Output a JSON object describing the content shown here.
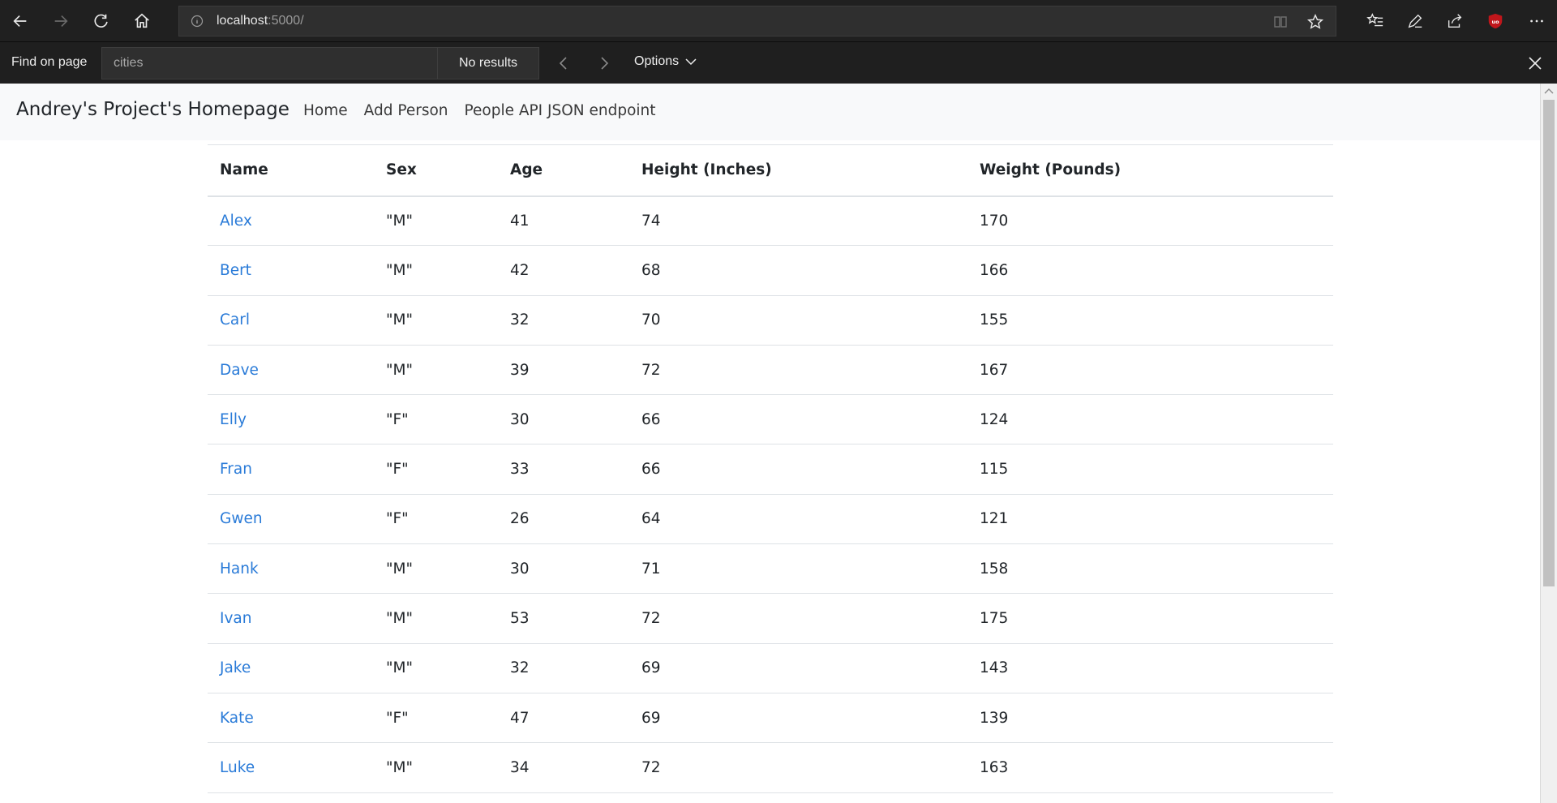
{
  "browser": {
    "url_host": "localhost",
    "url_rest": ":5000/"
  },
  "findbar": {
    "label": "Find on page",
    "query": "cities",
    "results": "No results",
    "options_label": "Options"
  },
  "navbar": {
    "brand": "Andrey's Project's Homepage",
    "links": [
      "Home",
      "Add Person",
      "People API JSON endpoint"
    ]
  },
  "table": {
    "headers": [
      "Name",
      "Sex",
      "Age",
      "Height (Inches)",
      "Weight (Pounds)"
    ],
    "rows": [
      [
        "Alex",
        "\"M\"",
        "41",
        "74",
        "170"
      ],
      [
        "Bert",
        "\"M\"",
        "42",
        "68",
        "166"
      ],
      [
        "Carl",
        "\"M\"",
        "32",
        "70",
        "155"
      ],
      [
        "Dave",
        "\"M\"",
        "39",
        "72",
        "167"
      ],
      [
        "Elly",
        "\"F\"",
        "30",
        "66",
        "124"
      ],
      [
        "Fran",
        "\"F\"",
        "33",
        "66",
        "115"
      ],
      [
        "Gwen",
        "\"F\"",
        "26",
        "64",
        "121"
      ],
      [
        "Hank",
        "\"M\"",
        "30",
        "71",
        "158"
      ],
      [
        "Ivan",
        "\"M\"",
        "53",
        "72",
        "175"
      ],
      [
        "Jake",
        "\"M\"",
        "32",
        "69",
        "143"
      ],
      [
        "Kate",
        "\"F\"",
        "47",
        "69",
        "139"
      ],
      [
        "Luke",
        "\"M\"",
        "34",
        "72",
        "163"
      ]
    ]
  },
  "colors": {
    "link": "#2a7bd8",
    "toolbar": "#202020",
    "navbar": "#f8f9fa"
  }
}
